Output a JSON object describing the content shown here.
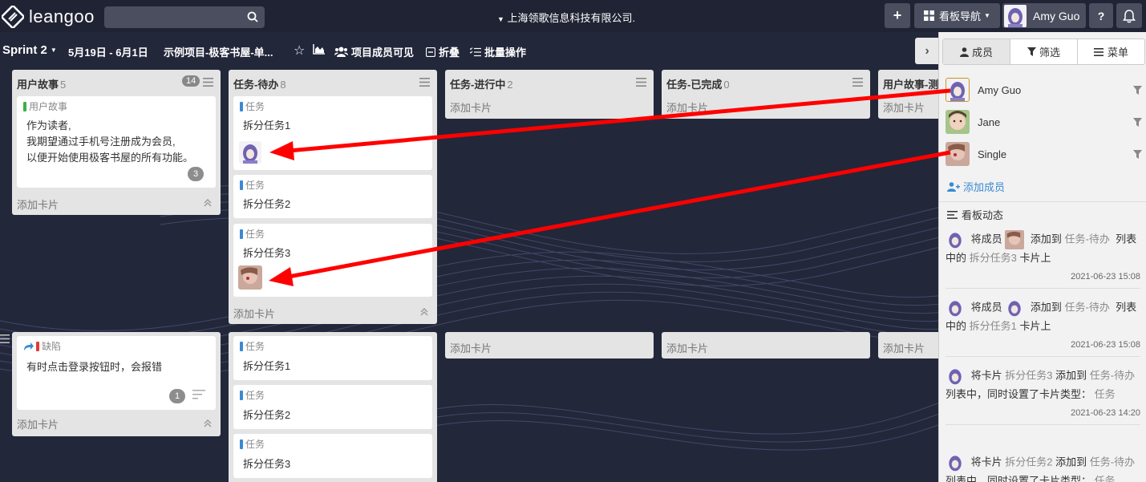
{
  "topbar": {
    "logo_text": "leangoo",
    "search_placeholder": "",
    "company": "上海领歌信息科技有限公司.",
    "board_nav": "看板导航",
    "user_name": "Amy Guo",
    "help": "?"
  },
  "subbar": {
    "sprint": "Sprint 2",
    "dates": "5月19日 - 6月1日",
    "project": "示例项目-极客书屋-单...",
    "visibility": "项目成员可见",
    "fold": "折叠",
    "batch": "批量操作"
  },
  "lists": [
    {
      "title": "用户故事",
      "count": "5",
      "badge": "14"
    },
    {
      "title": "任务-待办",
      "count": "8"
    },
    {
      "title": "任务-进行中",
      "count": "2"
    },
    {
      "title": "任务-已完成",
      "count": "0"
    },
    {
      "title": "用户故事-测"
    }
  ],
  "cards": {
    "story": {
      "type": "用户故事",
      "line1": "作为读者,",
      "line2": "我期望通过手机号注册成为会员,",
      "line3": "以便开始使用极客书屋的所有功能。",
      "count": "3"
    },
    "t1": {
      "type": "任务",
      "title": "拆分任务1"
    },
    "t2": {
      "type": "任务",
      "title": "拆分任务2"
    },
    "t3": {
      "type": "任务",
      "title": "拆分任务3"
    },
    "bug": {
      "type": "缺陷",
      "title": "有时点击登录按钮时，会报错",
      "count": "1"
    },
    "r2t1": {
      "type": "任务",
      "title": "拆分任务1"
    },
    "r2t2": {
      "type": "任务",
      "title": "拆分任务2"
    },
    "r2t3": {
      "type": "任务",
      "title": "拆分任务3"
    }
  },
  "add_card": "添加卡片",
  "panel": {
    "tabs": [
      "成员",
      "筛选",
      "菜单"
    ],
    "members": [
      "Amy Guo",
      "Jane",
      "Single"
    ],
    "add_member": "添加成员",
    "activity_title": "看板动态",
    "activities": [
      {
        "a": "将成员",
        "b": "添加到",
        "list": "任务-待办",
        "c": "列表中的",
        "card": "拆分任务3",
        "d": "卡片上",
        "time": "2021-06-23 15:08"
      },
      {
        "a": "将成员",
        "b": "添加到",
        "list": "任务-待办",
        "c": "列表中的",
        "card": "拆分任务1",
        "d": "卡片上",
        "time": "2021-06-23 15:08"
      },
      {
        "a": "将卡片",
        "card": "拆分任务3",
        "b": "添加到",
        "list": "任务-待办",
        "c": "列表中，同时设置了卡片类型：",
        "type": "任务",
        "time": "2021-06-23 14:20"
      },
      {
        "a": "将卡片",
        "card": "拆分任务2",
        "b": "添加到",
        "list": "任务-待办",
        "c": "列表中，同时设置了卡片类型：",
        "type": "任务"
      }
    ]
  },
  "colors": {
    "background": "#23273a",
    "accent_blue": "#3a8ad3",
    "story_green": "#3cb04a",
    "task_blue": "#3a8ad3",
    "bug_red": "#e03a3a",
    "arrow_red": "#ff0000"
  }
}
